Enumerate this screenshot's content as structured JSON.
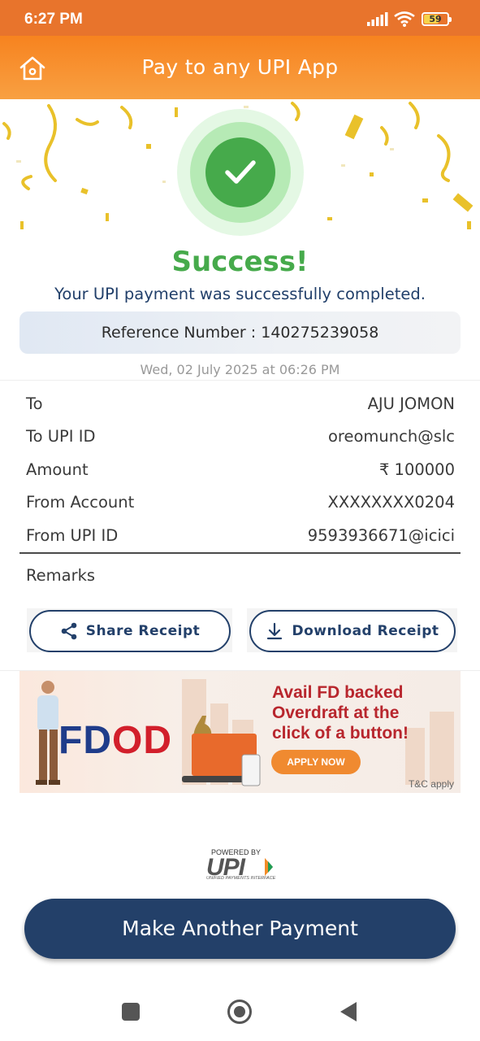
{
  "status_bar": {
    "time": "6:27 PM",
    "battery": "59"
  },
  "header": {
    "title": "Pay to any UPI App",
    "home_icon": "home-icon"
  },
  "result": {
    "heading": "Success!",
    "message": "Your UPI payment was successfully completed.",
    "reference": "Reference Number : 140275239058",
    "datetime": "Wed, 02 July 2025 at 06:26 PM"
  },
  "details": [
    {
      "label": "To",
      "value": "AJU JOMON"
    },
    {
      "label": "To UPI ID",
      "value": "oreomunch@slc"
    },
    {
      "label": "Amount",
      "value": "₹ 100000"
    },
    {
      "label": "From Account",
      "value": "XXXXXXXX0204"
    },
    {
      "label": "From UPI ID",
      "value": "9593936671@icici"
    }
  ],
  "remarks_label": "Remarks",
  "actions": {
    "share": "Share Receipt",
    "download": "Download Receipt"
  },
  "banner": {
    "brand_a": "FD",
    "brand_b": "OD",
    "headline_1": "Avail FD backed",
    "headline_2": "Overdraft at the",
    "headline_3": "click of a button!",
    "cta": "APPLY NOW",
    "disclaimer": "T&C apply"
  },
  "upi_badge": {
    "powered_by": "POWERED BY",
    "logo": "UPI",
    "subtitle": "UNIFIED PAYMENTS INTERFACE"
  },
  "primary_button": "Make Another Payment",
  "colors": {
    "header": "#f7831f",
    "success": "#46aa4b",
    "navy": "#234069"
  }
}
